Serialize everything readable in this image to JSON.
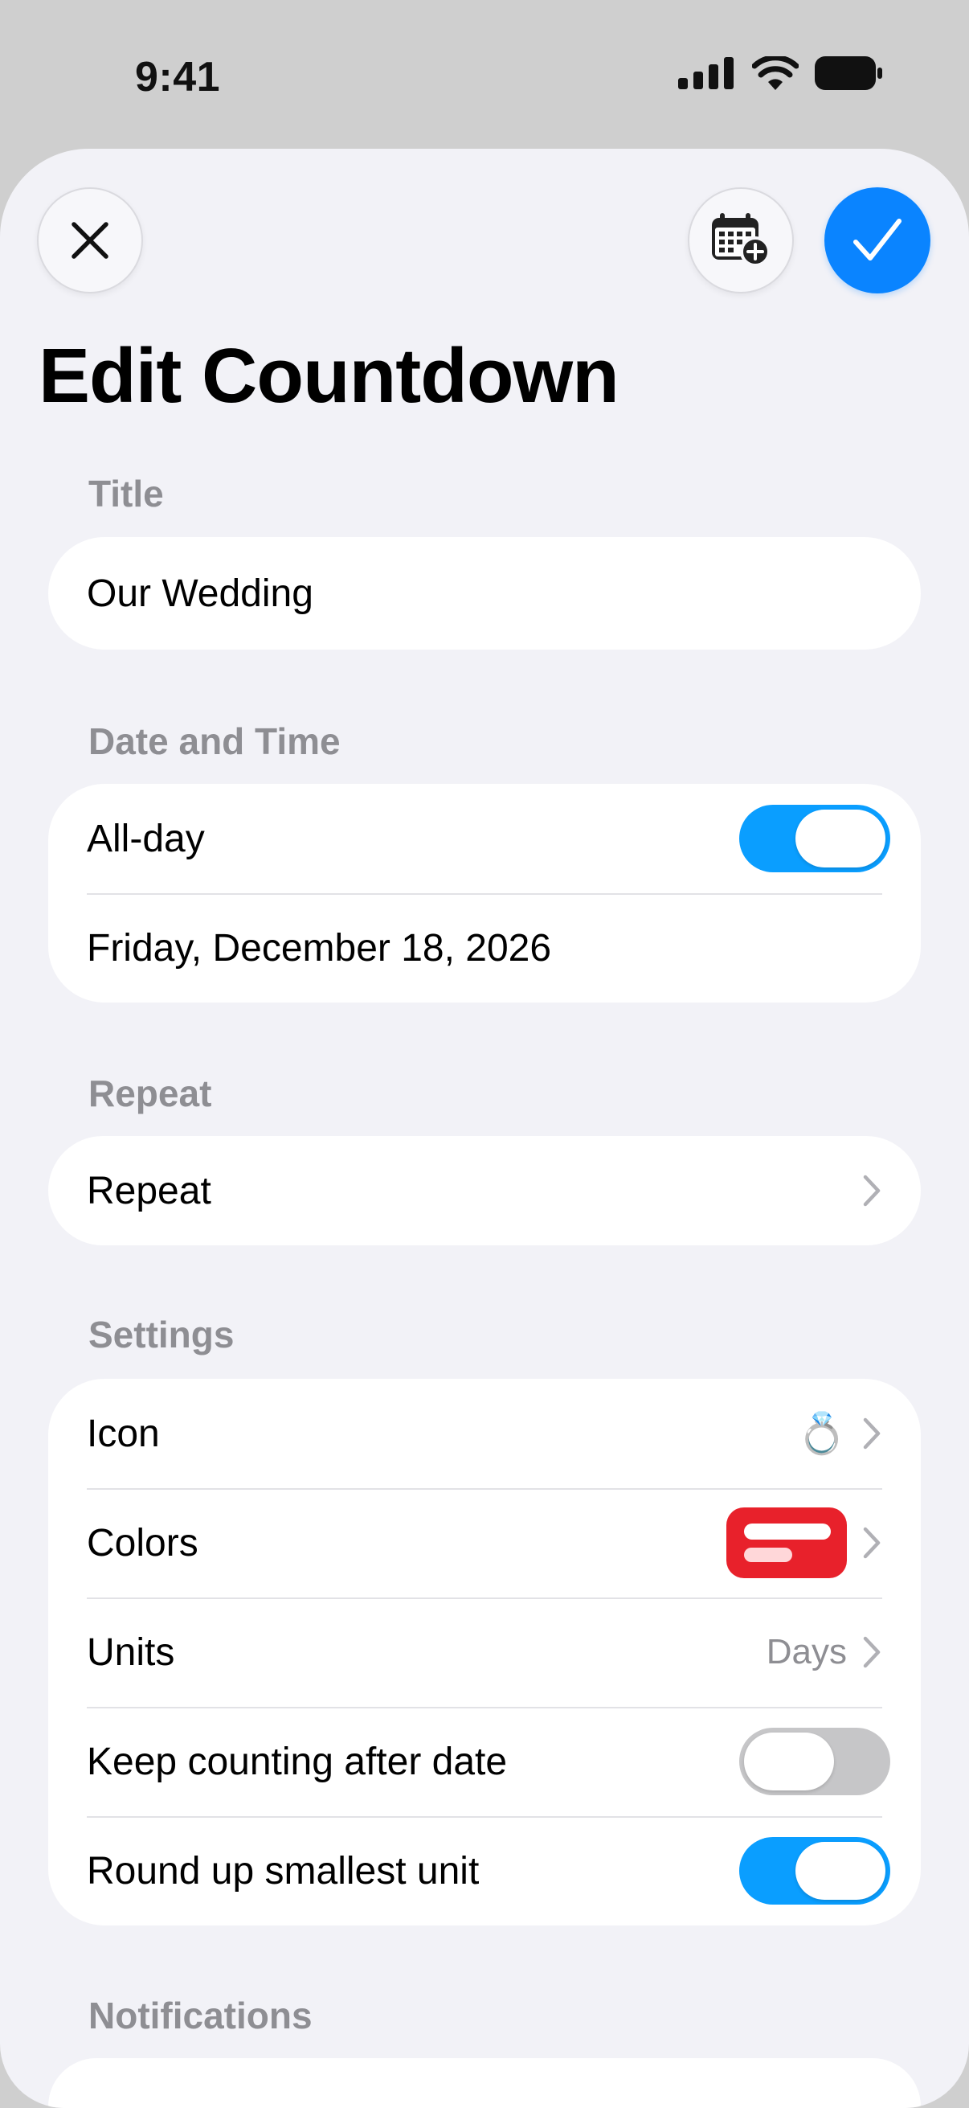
{
  "status_bar": {
    "time": "9:41"
  },
  "header": {
    "title": "Edit Countdown",
    "close_icon": "close-icon",
    "calendar_icon": "calendar-add-icon",
    "done_icon": "checkmark-icon"
  },
  "sections": {
    "title": {
      "header": "Title",
      "value": "Our Wedding"
    },
    "date_time": {
      "header": "Date and Time",
      "all_day_label": "All-day",
      "all_day_on": true,
      "date": "Friday, December 18, 2026"
    },
    "repeat": {
      "header": "Repeat",
      "label": "Repeat"
    },
    "settings": {
      "header": "Settings",
      "icon_label": "Icon",
      "icon_value": "💍",
      "colors_label": "Colors",
      "color_swatch": "#e8212b",
      "units_label": "Units",
      "units_value": "Days",
      "keep_counting_label": "Keep counting after date",
      "keep_counting_on": false,
      "round_up_label": "Round up smallest unit",
      "round_up_on": true
    },
    "notifications": {
      "header": "Notifications"
    }
  },
  "colors": {
    "accent": "#0a84ff",
    "toggle_on": "#0a9eff",
    "background": "#f2f2f7"
  }
}
